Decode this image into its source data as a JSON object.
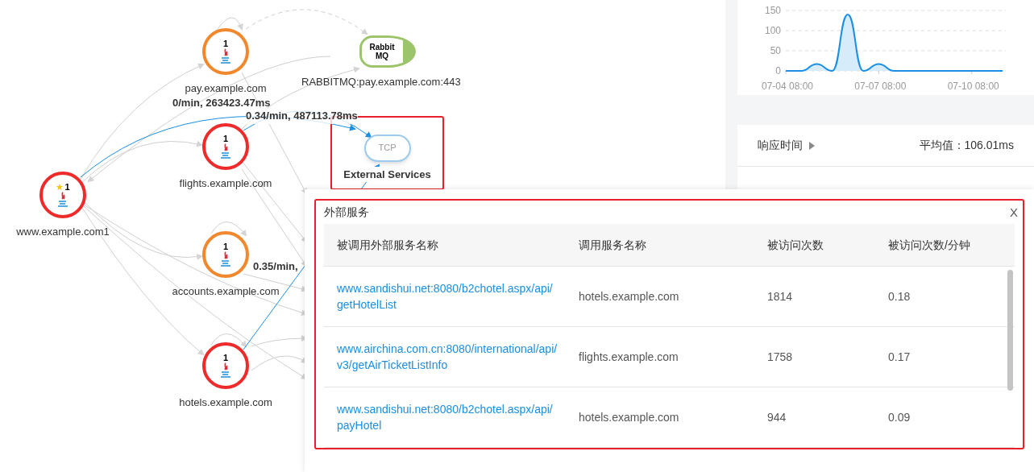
{
  "graph": {
    "nodes": [
      {
        "kind": "service",
        "label": "pay.example.com",
        "count": "1",
        "color": "#f0882e",
        "starred": false
      },
      {
        "kind": "service",
        "label": "flights.example.com",
        "count": "1",
        "color": "#ee2a2a",
        "starred": false
      },
      {
        "kind": "service",
        "label": "www.example.com1",
        "count": "1",
        "color": "#ee2a2a",
        "starred": true,
        "star": "★"
      },
      {
        "kind": "service",
        "label": "accounts.example.com",
        "count": "1",
        "color": "#f0882e",
        "starred": false
      },
      {
        "kind": "service",
        "label": "hotels.example.com",
        "count": "1",
        "color": "#ee2a2a",
        "starred": false
      }
    ],
    "queue": {
      "icon_lines": [
        "Rabbit",
        "MQ"
      ],
      "label": "RABBITMQ:pay.example.com:443"
    },
    "external": {
      "icon_text": "TCP",
      "label": "External Services",
      "highlighted": true
    },
    "edge_labels": [
      "0/min, 263423.47ms",
      "0.34/min, 487113.78ms",
      "0.35/min,"
    ]
  },
  "right_panel": {
    "chart_card": {
      "chart_data": {
        "type": "area",
        "categories": [
          "07-04 08:00",
          null,
          null,
          null,
          null,
          null,
          "07-07 08:00",
          null,
          null,
          null,
          null,
          null,
          "07-10 08:00",
          null,
          null
        ],
        "series": [
          {
            "color": "#1a8fe3",
            "values": [
              0,
              0,
              17,
              0,
              140,
              0,
              17,
              0,
              0,
              0,
              0,
              0,
              0,
              0,
              0
            ]
          }
        ],
        "yticks": [
          0,
          50,
          100,
          150
        ],
        "ylim": [
          0,
          150
        ]
      }
    },
    "response_card": {
      "title": "响应时间",
      "average": "平均值：106.01ms"
    }
  },
  "dialog": {
    "title": "外部服务",
    "close": "X",
    "highlighted": true,
    "table": {
      "columns": [
        "被调用外部服务名称",
        "调用服务名称",
        "被访问次数",
        "被访问次数/分钟"
      ],
      "rows": [
        {
          "external": "www.sandishui.net:8080/b2chotel.aspx/api/getHotelList",
          "caller": "hotels.example.com",
          "count": "1814",
          "per_minute": "0.18"
        },
        {
          "external": "www.airchina.com.cn:8080/international/api/v3/getAirTicketListInfo",
          "caller": "flights.example.com",
          "count": "1758",
          "per_minute": "0.17"
        },
        {
          "external": "www.sandishui.net:8080/b2chotel.aspx/api/payHotel",
          "caller": "hotels.example.com",
          "count": "944",
          "per_minute": "0.09"
        }
      ]
    }
  }
}
